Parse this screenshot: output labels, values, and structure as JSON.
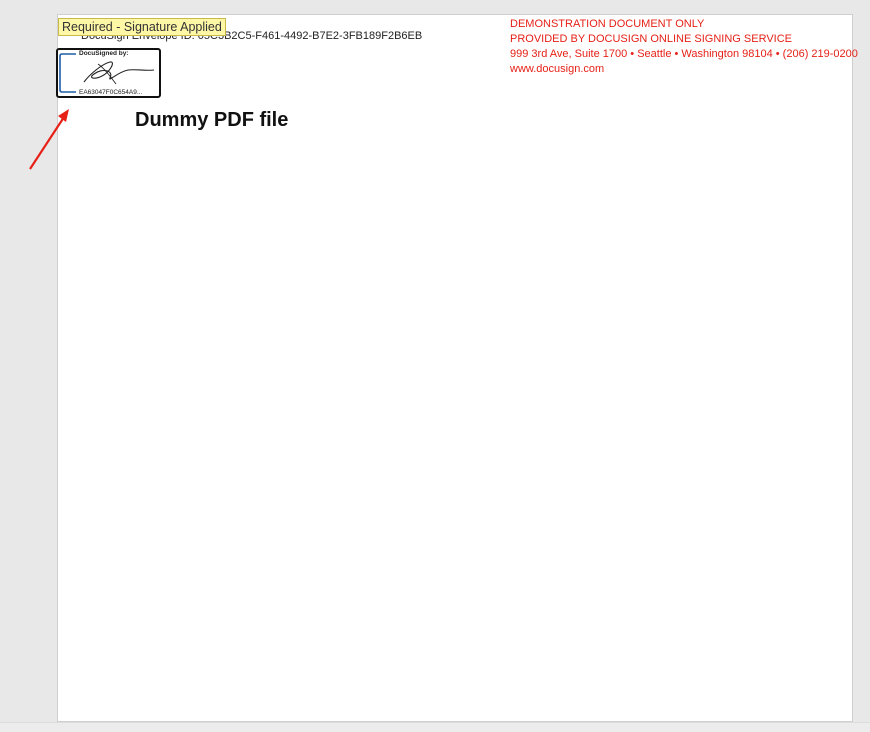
{
  "document": {
    "envelope_id": "DocuSign Envelope ID: 05C3B2C5-F461-4492-B7E2-3FB189F2B6EB",
    "title": "Dummy PDF file",
    "demo_lines": [
      "DEMONSTRATION DOCUMENT ONLY",
      "PROVIDED BY DOCUSIGN ONLINE SIGNING SERVICE",
      "999 3rd Ave, Suite 1700  • Seattle • Washington 98104 • (206) 219-0200",
      "www.docusign.com"
    ]
  },
  "signature": {
    "tooltip": "Required - Signature Applied",
    "label": "DocuSigned by:",
    "code": "EA63047F0C654A9..."
  },
  "colors": {
    "demo_text": "#e62117",
    "tooltip_bg": "#fdf7a6",
    "annotation_arrow": "#e62117",
    "sig_frame": "#1f5fa8"
  }
}
